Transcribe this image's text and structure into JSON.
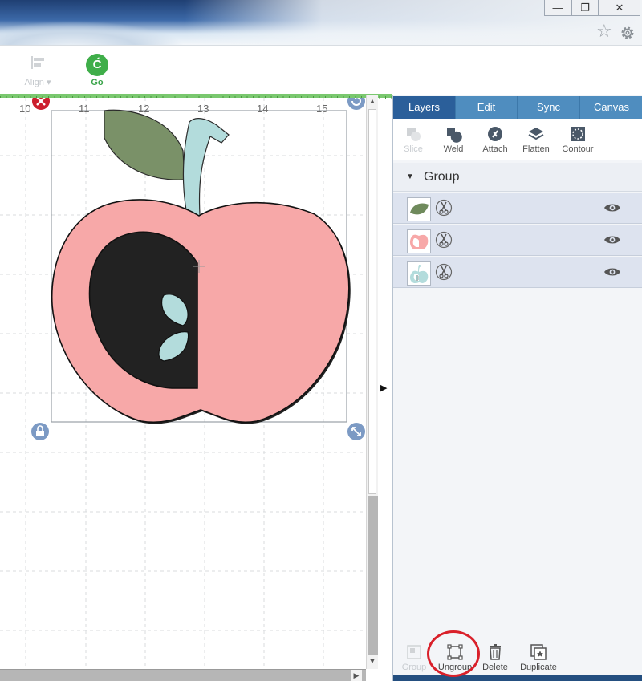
{
  "window": {
    "minimize_glyph": "—",
    "restore_glyph": "❐",
    "close_glyph": "✕",
    "favorite_icon": "star-icon",
    "settings_icon": "gear-icon"
  },
  "toolbar": {
    "align_label": "Align",
    "go_label": "Go",
    "go_glyph": "Ć",
    "go_color": "#3fae49"
  },
  "ruler": {
    "labels": [
      "10",
      "11",
      "12",
      "13",
      "14",
      "15"
    ]
  },
  "panel": {
    "tabs": [
      {
        "label": "Layers",
        "active": true
      },
      {
        "label": "Edit",
        "active": false
      },
      {
        "label": "Sync",
        "active": false
      },
      {
        "label": "Canvas",
        "active": false
      }
    ],
    "operations": [
      {
        "label": "Slice",
        "enabled": false
      },
      {
        "label": "Weld",
        "enabled": true
      },
      {
        "label": "Attach",
        "enabled": true
      },
      {
        "label": "Flatten",
        "enabled": true
      },
      {
        "label": "Contour",
        "enabled": true
      }
    ],
    "group_label": "Group",
    "layers": [
      {
        "name": "leaf",
        "color": "#6f8a5c"
      },
      {
        "name": "apple",
        "color": "#f7a8a8"
      },
      {
        "name": "stem-seeds",
        "color": "#b3dcdc"
      }
    ],
    "bottom_actions": [
      {
        "label": "Group",
        "enabled": false
      },
      {
        "label": "Ungroup",
        "enabled": true
      },
      {
        "label": "Delete",
        "enabled": true
      },
      {
        "label": "Duplicate",
        "enabled": true
      }
    ],
    "accent_color": "#2b5f9a"
  },
  "design": {
    "apple_color": "#f7a8a8",
    "leaf_color": "#7a9168",
    "stem_color": "#b3dcdc",
    "seed_color": "#b3dcdc"
  }
}
